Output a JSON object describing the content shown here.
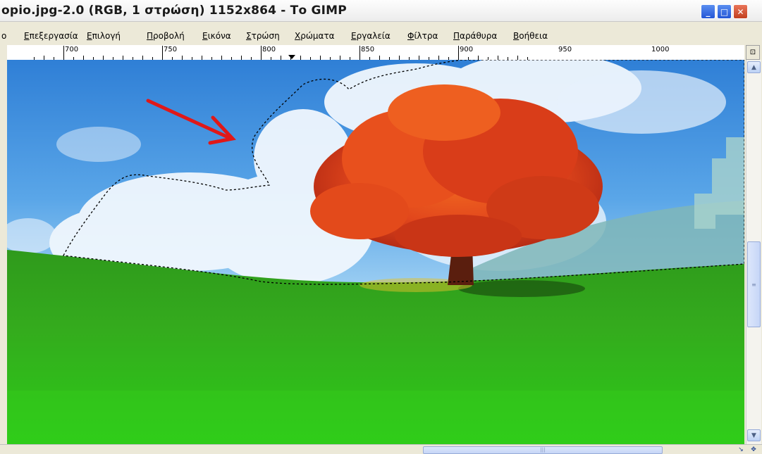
{
  "window": {
    "title": "opio.jpg-2.0 (RGB, 1 στρώση) 1152x864 - Το GIMP",
    "minimize_label": "_",
    "maximize_label": "□",
    "close_label": "✕"
  },
  "menu": {
    "items": [
      {
        "label": "ο",
        "accel": ""
      },
      {
        "label": "πεξεργασία",
        "accel": "Ε"
      },
      {
        "label": "πιλογή",
        "accel": "Ε"
      },
      {
        "label": "ροβολή",
        "accel": "Π"
      },
      {
        "label": "ικόνα",
        "accel": "Ε"
      },
      {
        "label": "τρώση",
        "accel": "Σ"
      },
      {
        "label": "ρώματα",
        "accel": "Χ"
      },
      {
        "label": "ργαλεία",
        "accel": "Ε"
      },
      {
        "label": "ίλτρα",
        "accel": "Φ"
      },
      {
        "label": "αράθυρα",
        "accel": "Π"
      },
      {
        "label": "οήθεια",
        "accel": "Β"
      }
    ]
  },
  "ruler": {
    "labels": [
      "700",
      "750",
      "800",
      "850",
      "900",
      "950",
      "1000"
    ],
    "units_per_label": 50
  },
  "scrollbars": {
    "up_icon": "▲",
    "down_icon": "▼",
    "grip": "≡",
    "hgrip": "|||",
    "zoom_icon": "⊡",
    "nav_icon": "✥",
    "quickmask_icon": "↘"
  },
  "colors": {
    "sky_top": "#2f7fd6",
    "sky_bottom": "#7fbef0",
    "cloud": "#f3f8fd",
    "grass_top": "#34a51d",
    "grass_bottom": "#2bc818",
    "tree_foliage": "#e2471c",
    "arrow": "#e01818",
    "selection": "#000000"
  }
}
